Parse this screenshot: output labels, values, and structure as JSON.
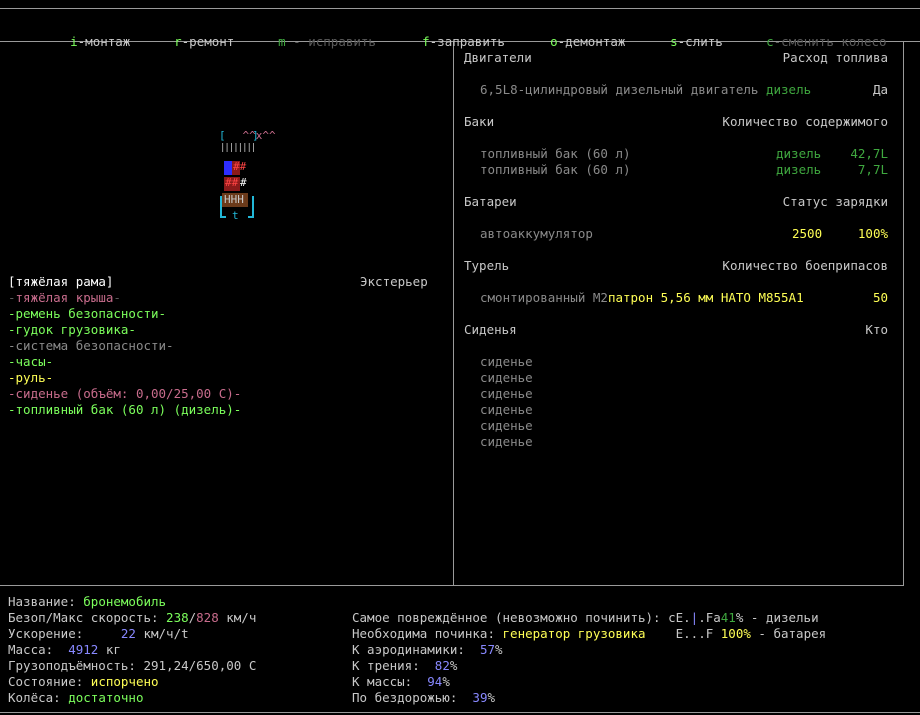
{
  "menu": {
    "items": [
      {
        "key": "i",
        "label": "-монтаж",
        "state": "active"
      },
      {
        "key": "r",
        "label": "-ремонт",
        "state": "active"
      },
      {
        "key": "m",
        "label": " - исправить",
        "state": "disabled"
      },
      {
        "key": "f",
        "label": "-заправить",
        "state": "active"
      },
      {
        "key": "o",
        "label": "-демонтаж",
        "state": "active"
      },
      {
        "key": "s",
        "label": "-слить",
        "state": "active"
      },
      {
        "key": "c",
        "label": "-сменить колесо",
        "state": "disabled"
      },
      {
        "key": "w",
        "label": "",
        "state": "active"
      }
    ]
  },
  "vehicle_art": {
    "top": "^^x^^",
    "bracket_top": "[    ]",
    "rail": "||||||||",
    "row1": "##",
    "row2": "##",
    "row3": "HHH",
    "bottom": "t"
  },
  "parts": {
    "selected": "тяжёлая рама",
    "category": "Экстерьер",
    "items": [
      {
        "label": "тяжёлая крыша",
        "color": "pink"
      },
      {
        "label": "ремень безопасности",
        "color": "green"
      },
      {
        "label": "гудок грузовика",
        "color": "green"
      },
      {
        "label": "система безопасности",
        "color": "gray"
      },
      {
        "label": "часы",
        "color": "green"
      },
      {
        "label": "руль",
        "color": "yellow"
      },
      {
        "label": "сиденье (объём: 0,00/25,00 С)",
        "color": "pink"
      },
      {
        "label": "топливный бак (60 л) (дизель)",
        "color": "green"
      }
    ]
  },
  "engines": {
    "header": "Двигатели",
    "header_right": "Расход топлива",
    "rows": [
      {
        "name": "6,5L8-цилиндровый дизельный двигатель",
        "fuel": "дизель",
        "value": "Да"
      }
    ]
  },
  "tanks": {
    "header": "Баки",
    "header_right": "Количество содержимого",
    "rows": [
      {
        "name": "топливный бак (60 л)",
        "fuel": "дизель",
        "amount": "42,7L"
      },
      {
        "name": "топливный бак (60 л)",
        "fuel": "дизель",
        "amount": "7,7L"
      }
    ]
  },
  "batteries": {
    "header": "Батареи",
    "header_right": "Статус зарядки",
    "rows": [
      {
        "name": "автоаккумулятор",
        "charge": "2500",
        "percent": "100%"
      }
    ]
  },
  "turret": {
    "header": "Турель",
    "header_right": "Количество боеприпасов",
    "rows": [
      {
        "name": "смонтированный M2",
        "ammo": "патрон 5,56 мм НАТО M855A1",
        "count": "50"
      }
    ]
  },
  "seats": {
    "header": "Сиденья",
    "header_right": "Кто",
    "rows": [
      "сиденье",
      "сиденье",
      "сиденье",
      "сиденье",
      "сиденье",
      "сиденье"
    ]
  },
  "info": {
    "name_label": "Название: ",
    "name": "бронемобиль",
    "speed_label": "Безоп/Макс скорость: ",
    "speed_safe": "238",
    "speed_sep": "/",
    "speed_max": "828",
    "speed_unit": " км/ч",
    "accel_label": "Ускорение:     ",
    "accel": "22",
    "accel_unit": " км/ч/t",
    "mass_label": "Масса:  ",
    "mass": "4912",
    "mass_unit": " кг",
    "cargo_label": "Грузоподъёмность: ",
    "cargo": "291,24/650,00 С",
    "state_label": "Состояние: ",
    "state": "испорчено",
    "wheels_label": "Колёса: ",
    "wheels": "достаточно",
    "damaged_label": "Самое повреждённое (невозможно починить): ",
    "damaged_gauge_a": "cE.",
    "damaged_gauge_bar": "|",
    "damaged_gauge_b": ".Fa",
    "damaged_pct": "41",
    "damaged_tail": "% - дизельи",
    "repair_label": "Необходима починка: ",
    "repair": "генератор грузовика",
    "repair_gauge": "    E...F ",
    "repair_pct": "100%",
    "repair_tail": " - батарея",
    "aero_label": "К аэродинамики:  ",
    "aero": "57",
    "aero_pct": "%",
    "friction_label": "К трения:  ",
    "friction": "82",
    "friction_pct": "%",
    "massk_label": "К массы:  ",
    "massk": "94",
    "massk_pct": "%",
    "offroad_label": "По бездорожью:  ",
    "offroad": "39",
    "offroad_pct": "%"
  },
  "colors": {
    "border": "#9a9a9a",
    "key_green": "#7cff5c",
    "disabled": "#5a5a5a"
  }
}
